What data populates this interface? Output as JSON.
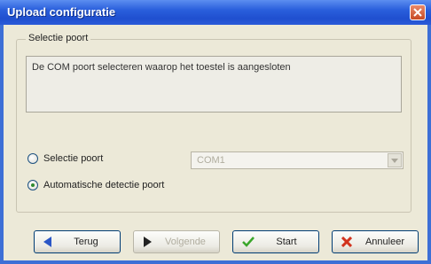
{
  "window": {
    "title": "Upload configuratie"
  },
  "group": {
    "legend": "Selectie poort",
    "description": "De COM poort selecteren waarop het toestel is aangesloten"
  },
  "options": [
    {
      "label": "Selectie poort",
      "checked": false
    },
    {
      "label": "Automatische detectie poort",
      "checked": true
    }
  ],
  "combo": {
    "value": "COM1"
  },
  "buttons": {
    "back": "Terug",
    "next": "Volgende",
    "start": "Start",
    "cancel": "Annuleer"
  }
}
